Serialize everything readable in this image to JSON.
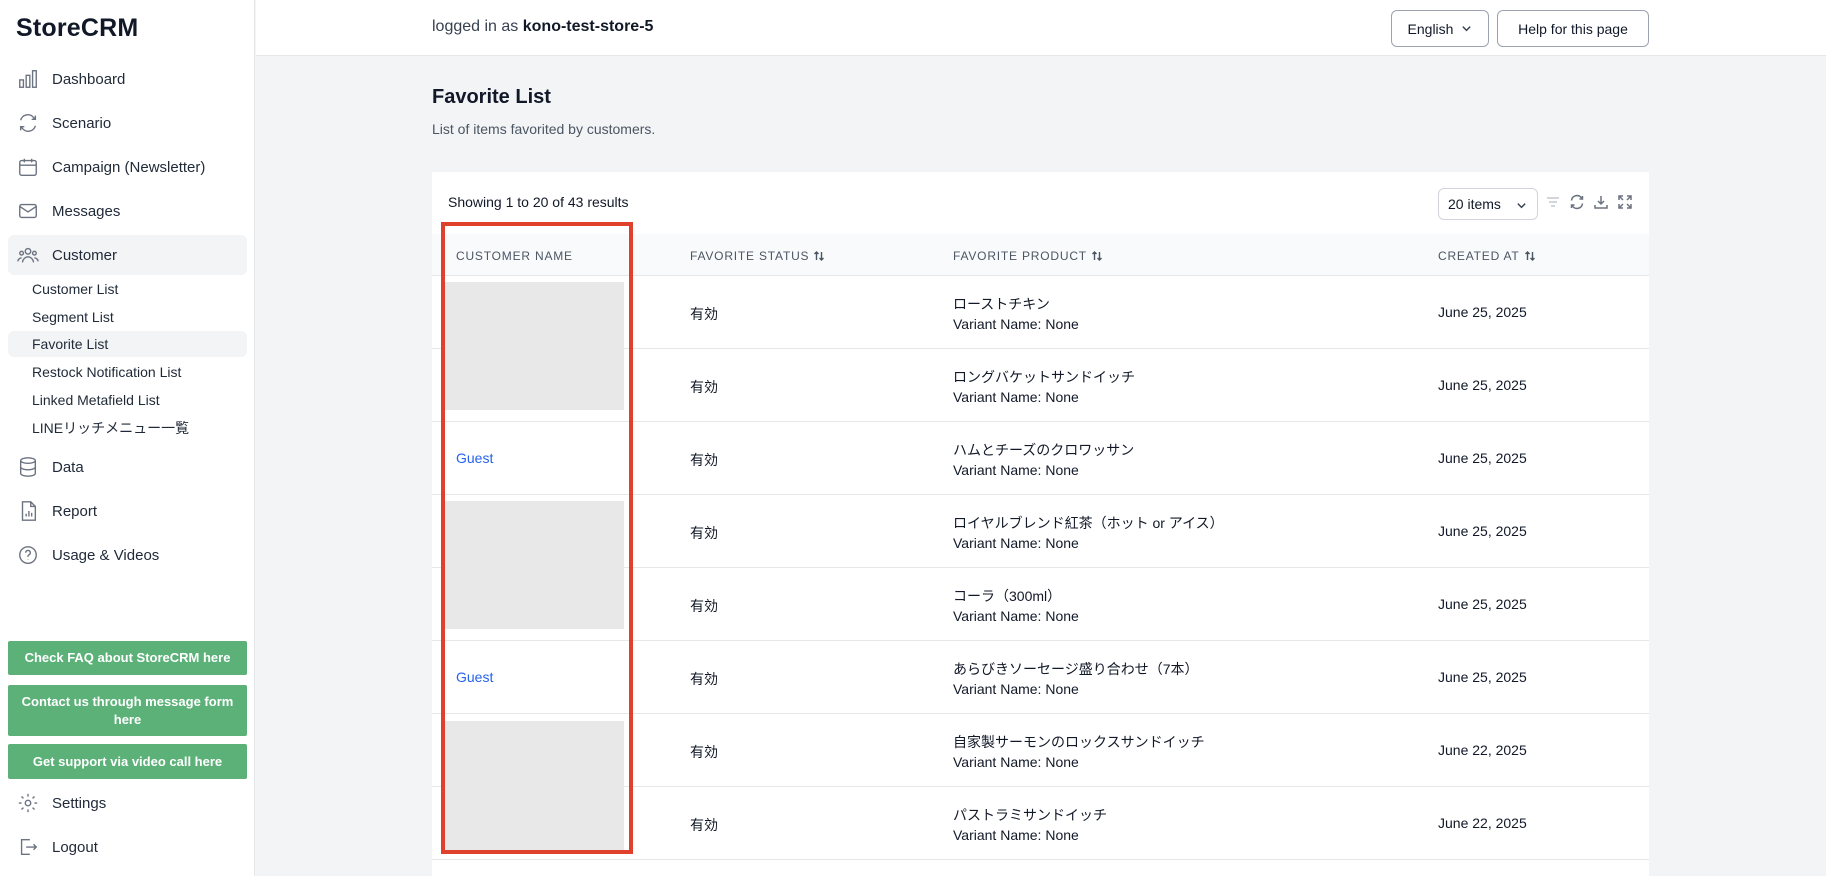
{
  "app": {
    "name": "StoreCRM"
  },
  "topbar": {
    "logged_prefix": "logged in as",
    "store": "kono-test-store-5",
    "language": "English",
    "help": "Help for this page"
  },
  "sidebar": {
    "items": [
      {
        "label": "Dashboard",
        "icon": "bar-chart-icon"
      },
      {
        "label": "Scenario",
        "icon": "refresh-icon"
      },
      {
        "label": "Campaign (Newsletter)",
        "icon": "calendar-icon"
      },
      {
        "label": "Messages",
        "icon": "mail-icon"
      },
      {
        "label": "Customer",
        "icon": "users-icon"
      }
    ],
    "customer_sub": [
      {
        "label": "Customer List"
      },
      {
        "label": "Segment List"
      },
      {
        "label": "Favorite List"
      },
      {
        "label": "Restock Notification List"
      },
      {
        "label": "Linked Metafield List"
      },
      {
        "label": "LINEリッチメニュー一覧"
      }
    ],
    "items2": [
      {
        "label": "Data",
        "icon": "database-icon"
      },
      {
        "label": "Report",
        "icon": "document-chart-icon"
      },
      {
        "label": "Usage & Videos",
        "icon": "question-icon"
      }
    ],
    "green_buttons": [
      "Check FAQ about StoreCRM here",
      "Contact us through message form here",
      "Get support via video call here"
    ],
    "settings": "Settings",
    "logout": "Logout"
  },
  "page": {
    "title": "Favorite List",
    "description": "List of items favorited by customers."
  },
  "table": {
    "showing": "Showing 1 to 20 of 43 results",
    "per_page": "20 items",
    "headers": {
      "customer": "CUSTOMER NAME",
      "status": "FAVORITE STATUS",
      "product": "FAVORITE PRODUCT",
      "created": "CREATED AT"
    },
    "rows": [
      {
        "customer": "",
        "status": "有効",
        "product": "ローストチキン",
        "variant": "Variant Name: None",
        "created": "June 25, 2025"
      },
      {
        "customer": "",
        "status": "有効",
        "product": "ロングバケットサンドイッチ",
        "variant": "Variant Name: None",
        "created": "June 25, 2025"
      },
      {
        "customer": "Guest",
        "status": "有効",
        "product": "ハムとチーズのクロワッサン",
        "variant": "Variant Name: None",
        "created": "June 25, 2025"
      },
      {
        "customer": "",
        "status": "有効",
        "product": "ロイヤルブレンド紅茶（ホット or アイス）",
        "variant": "Variant Name: None",
        "created": "June 25, 2025"
      },
      {
        "customer": "",
        "status": "有効",
        "product": "コーラ（300ml）",
        "variant": "Variant Name: None",
        "created": "June 25, 2025"
      },
      {
        "customer": "Guest",
        "status": "有効",
        "product": "あらびきソーセージ盛り合わせ（7本）",
        "variant": "Variant Name: None",
        "created": "June 25, 2025"
      },
      {
        "customer": "",
        "status": "有効",
        "product": "自家製サーモンのロックスサンドイッチ",
        "variant": "Variant Name: None",
        "created": "June 22, 2025"
      },
      {
        "customer": "",
        "status": "有効",
        "product": "パストラミサンドイッチ",
        "variant": "Variant Name: None",
        "created": "June 22, 2025"
      }
    ]
  },
  "colors": {
    "accent_green": "#5cb178",
    "link_blue": "#2563eb",
    "highlight_red": "#e0412c"
  }
}
